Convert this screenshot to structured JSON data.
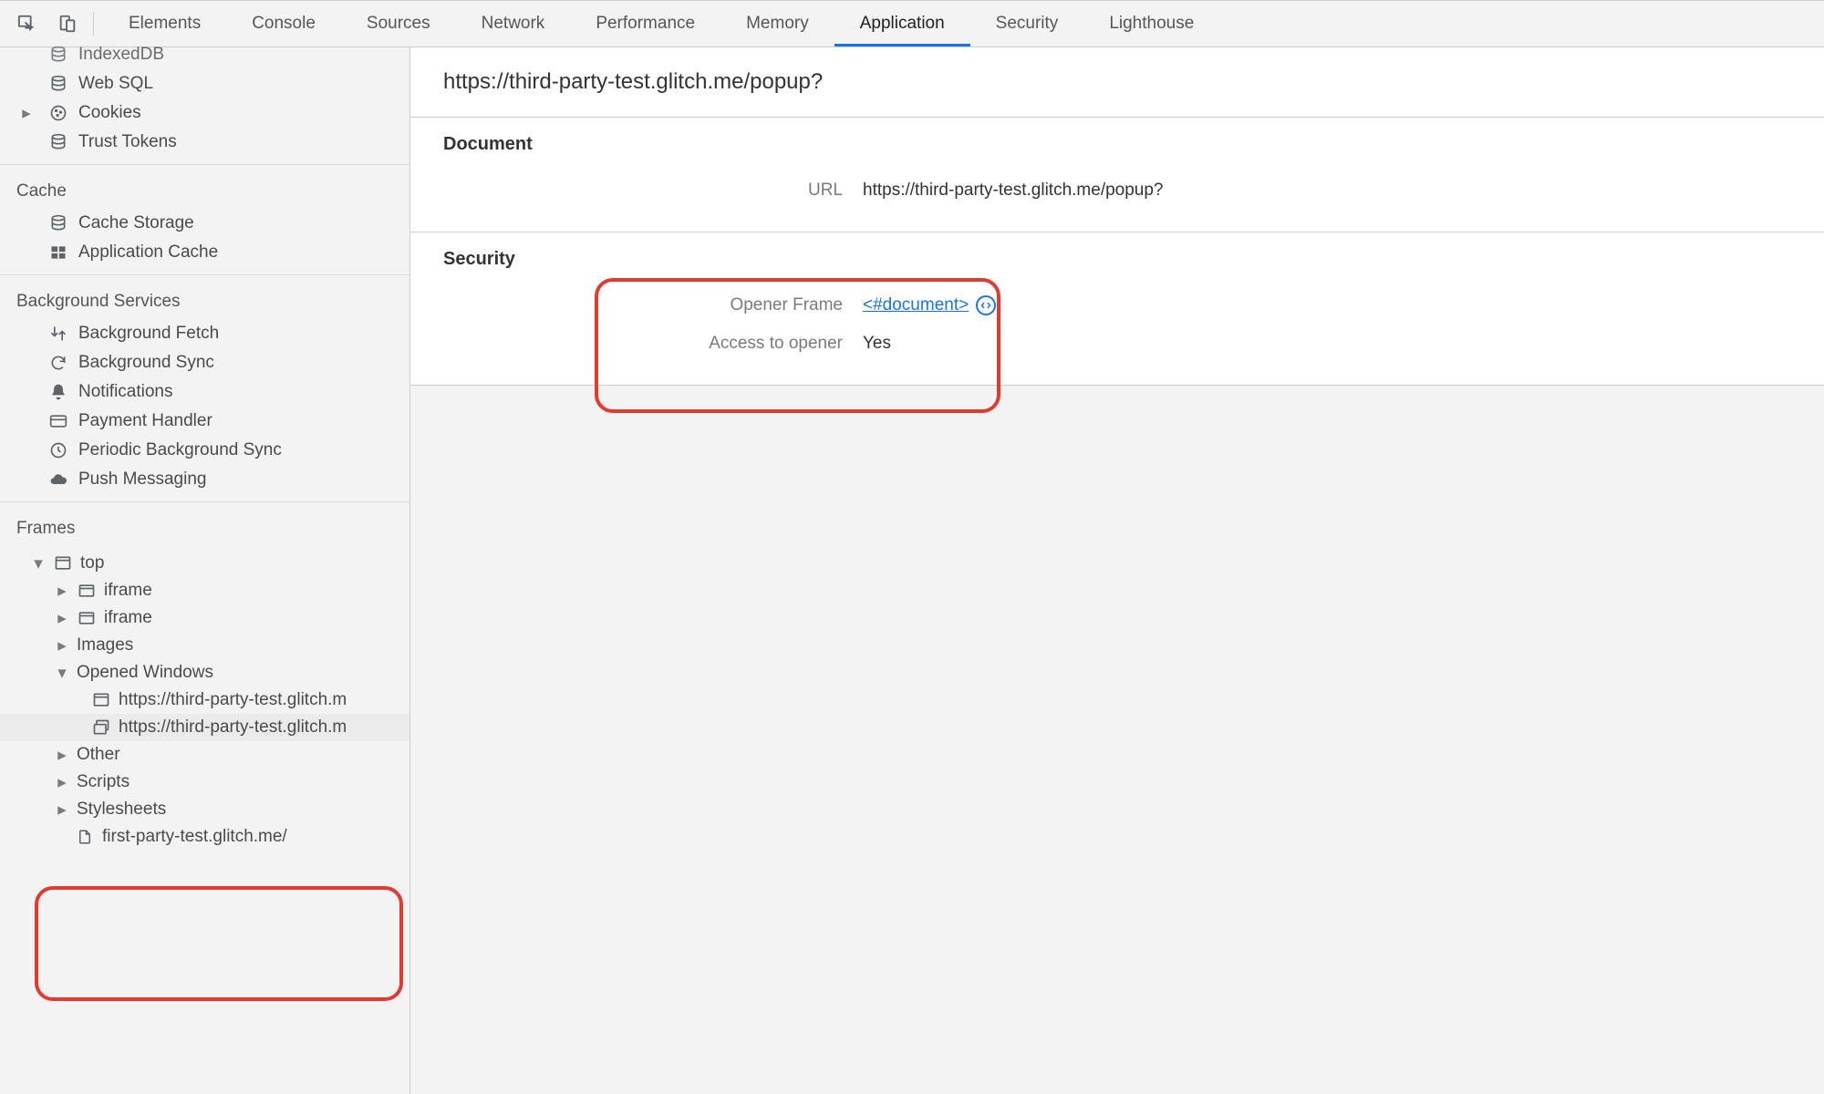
{
  "tabs": {
    "items": [
      "Elements",
      "Console",
      "Sources",
      "Network",
      "Performance",
      "Memory",
      "Application",
      "Security",
      "Lighthouse"
    ],
    "active": "Application"
  },
  "sidebar": {
    "storage": {
      "header": null,
      "items": [
        "IndexedDB",
        "Web SQL",
        "Cookies",
        "Trust Tokens"
      ]
    },
    "cache": {
      "header": "Cache",
      "items": [
        "Cache Storage",
        "Application Cache"
      ]
    },
    "background": {
      "header": "Background Services",
      "items": [
        "Background Fetch",
        "Background Sync",
        "Notifications",
        "Payment Handler",
        "Periodic Background Sync",
        "Push Messaging"
      ]
    },
    "frames": {
      "header": "Frames",
      "top": "top",
      "iframe1": "iframe",
      "iframe2": "iframe",
      "images": "Images",
      "opened_windows": "Opened Windows",
      "ow1": "https://third-party-test.glitch.m",
      "ow2": "https://third-party-test.glitch.m",
      "other": "Other",
      "scripts": "Scripts",
      "stylesheets": "Stylesheets",
      "file1": "first-party-test.glitch.me/"
    }
  },
  "content": {
    "title": "https://third-party-test.glitch.me/popup?",
    "document": {
      "heading": "Document",
      "url_label": "URL",
      "url_value": "https://third-party-test.glitch.me/popup?"
    },
    "security": {
      "heading": "Security",
      "opener_frame_label": "Opener Frame",
      "opener_frame_value": "<#document>",
      "access_label": "Access to opener",
      "access_value": "Yes"
    }
  }
}
